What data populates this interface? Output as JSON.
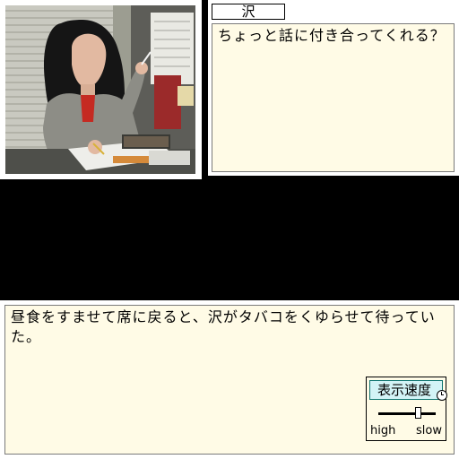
{
  "scene": {
    "speaker_name": "沢",
    "dialogue": "ちょっと話に付き合ってくれる？",
    "narration": "昼食をすませて席に戻ると、沢がタバコをくゆらせて待っていた。"
  },
  "speed_control": {
    "title": "表示速度",
    "high_label": "high",
    "slow_label": "slow",
    "level": 0.7
  },
  "colors": {
    "panel_bg": "#fffbe6",
    "speed_title_bg": "#d3f3f6"
  }
}
